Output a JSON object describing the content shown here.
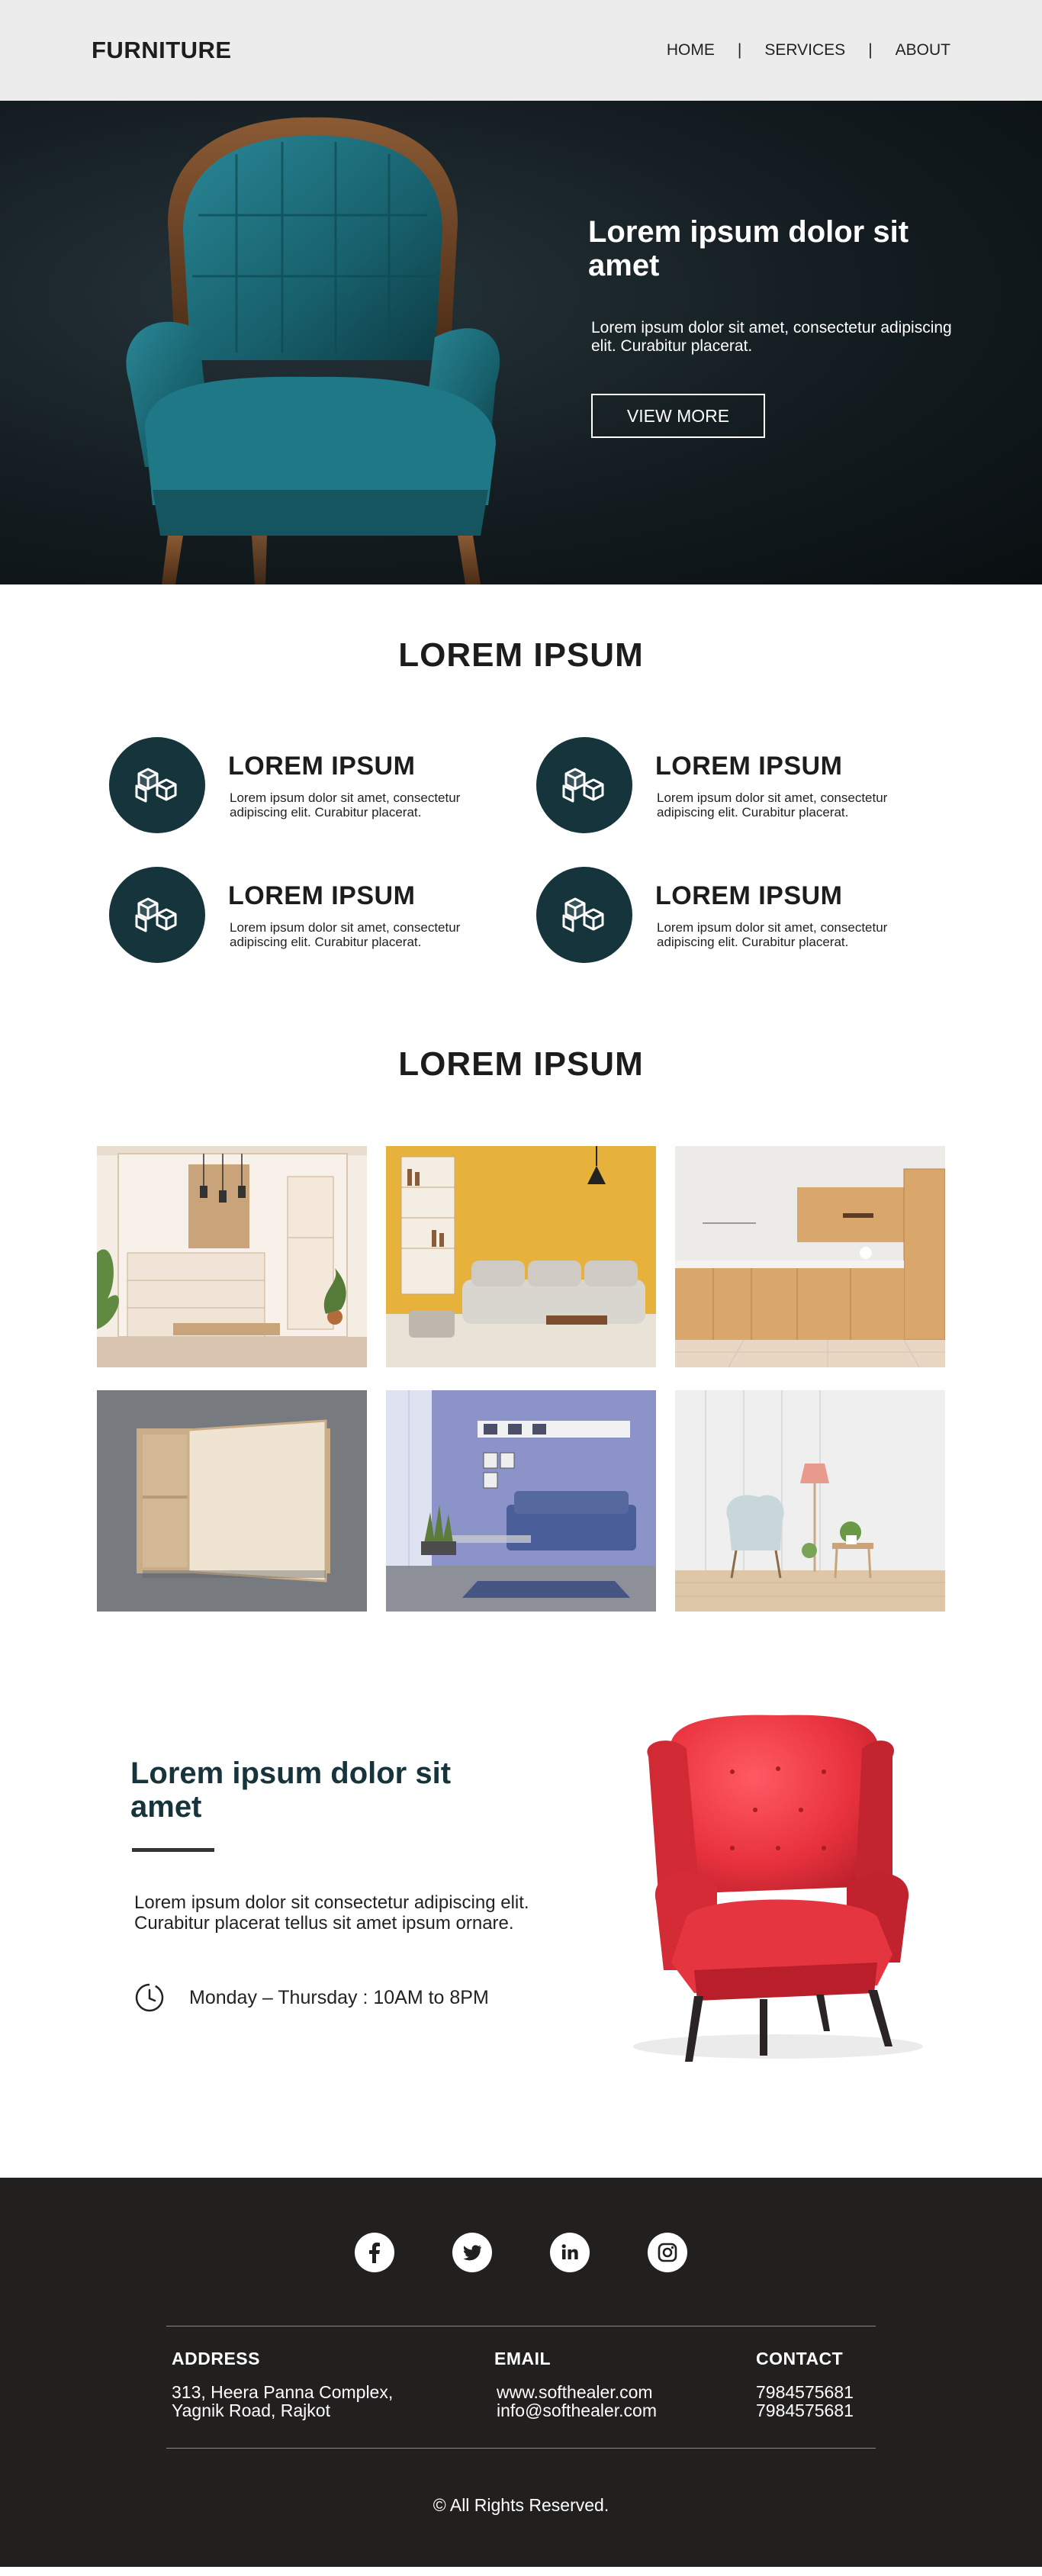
{
  "header": {
    "logo": "FURNITURE",
    "nav": [
      {
        "label": "HOME"
      },
      {
        "label": "SERVICES"
      },
      {
        "label": "ABOUT"
      }
    ],
    "separator": "|"
  },
  "hero": {
    "title": "Lorem ipsum dolor sit amet",
    "description": "Lorem ipsum dolor sit amet, consectetur adipiscing elit. Curabitur placerat.",
    "button_label": "VIEW MORE"
  },
  "features": {
    "title": "LOREM IPSUM",
    "items": [
      {
        "title": "LOREM IPSUM",
        "desc": "Lorem ipsum dolor sit amet, consectetur adipiscing elit. Curabitur placerat.",
        "icon": "boxes-icon"
      },
      {
        "title": "LOREM IPSUM",
        "desc": "Lorem ipsum dolor sit amet, consectetur adipiscing elit. Curabitur placerat.",
        "icon": "boxes-icon"
      },
      {
        "title": "LOREM IPSUM",
        "desc": "Lorem ipsum dolor sit amet, consectetur adipiscing elit. Curabitur placerat.",
        "icon": "boxes-icon"
      },
      {
        "title": "LOREM IPSUM",
        "desc": "Lorem ipsum dolor sit amet, consectetur adipiscing elit. Curabitur placerat.",
        "icon": "boxes-icon"
      }
    ]
  },
  "gallery": {
    "title": "LOREM IPSUM"
  },
  "promo": {
    "title": "Lorem ipsum dolor sit amet",
    "description": "Lorem ipsum dolor sit consectetur adipiscing elit. Curabitur placerat tellus sit amet ipsum ornare.",
    "hours": "Monday – Thursday : 10AM to 8PM"
  },
  "footer": {
    "socials": [
      "facebook-icon",
      "twitter-icon",
      "linkedin-icon",
      "instagram-icon"
    ],
    "address": {
      "heading": "ADDRESS",
      "line1": "313, Heera Panna Complex,",
      "line2": "Yagnik Road, Rajkot"
    },
    "email": {
      "heading": "EMAIL",
      "line1": "www.softhealer.com",
      "line2": "info@softhealer.com"
    },
    "contact": {
      "heading": "CONTACT",
      "line1": "7984575681",
      "line2": "7984575681"
    },
    "copyright": "© All Rights Reserved."
  },
  "colors": {
    "primary_dark": "#16343c",
    "header_bg": "#ececec",
    "footer_bg": "#221f1f",
    "accent_red": "#e8323e"
  }
}
